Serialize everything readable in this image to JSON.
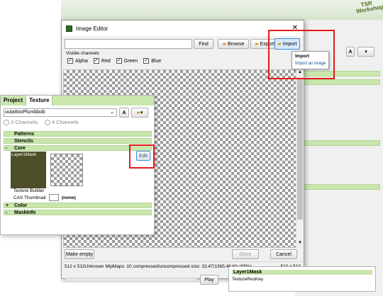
{
  "dialog": {
    "title": "Image Editor",
    "find_label": "Find",
    "browse_label": "Browse",
    "export_label": "Export",
    "import_label": "Import",
    "visible_channels_label": "Visible channels",
    "channels": [
      "Alpha",
      "Red",
      "Green",
      "Blue"
    ],
    "make_empty_label": "Make empty",
    "done_label": "Done",
    "cancel_label": "Cancel",
    "status_info": "512 x 512Unknown MipMaps: 10 compressed/uncompressed size: 33.47/1365.46 Kb (98%)",
    "status_size": "510 x 510"
  },
  "import_menu": {
    "title": "Import",
    "item": "Import an image"
  },
  "texture_panel": {
    "tabs": [
      "Project",
      "Texture"
    ],
    "texture_name": "uutattooPlumbbob",
    "font_label": "A",
    "radio_options": [
      "3 Channels",
      "4 Channels"
    ],
    "rows": {
      "patterns": "Patterns",
      "stencils": "Stencils",
      "core": "Core",
      "color": "Color",
      "maskinfo": "MaskInfo"
    },
    "layer_label": "Layer1Mask",
    "edit_label": "Edit",
    "texture_builder_label": "Texture Builder",
    "cas_thumbnail_label": "CAS Thumbnail",
    "cas_thumbnail_value": "(none)"
  },
  "bottom_right": {
    "title": "Layer1Mask",
    "key": "TextureResKey"
  },
  "play_label": "Play",
  "background_right_font": "A",
  "logo_text": "TSR Workshop"
}
